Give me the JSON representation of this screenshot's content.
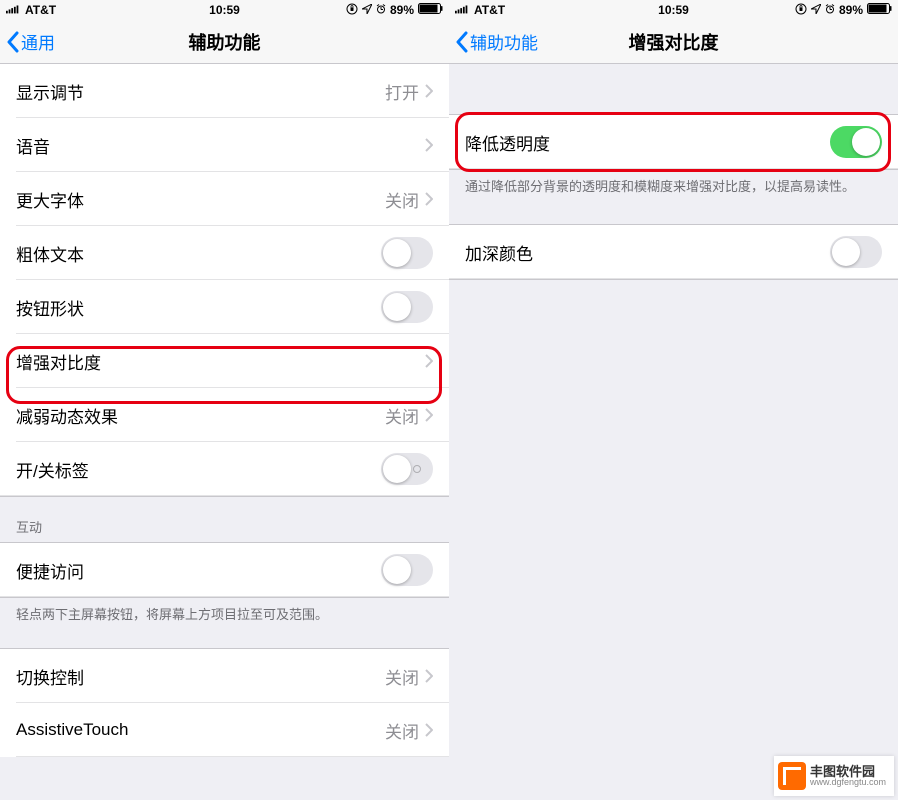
{
  "status": {
    "carrier": "AT&T",
    "time": "10:59",
    "battery_pct": "89%"
  },
  "left": {
    "back_label": "通用",
    "title": "辅助功能",
    "rows": {
      "display": {
        "label": "显示调节",
        "value": "打开"
      },
      "voice": {
        "label": "语音"
      },
      "larger": {
        "label": "更大字体",
        "value": "关闭"
      },
      "bold": {
        "label": "粗体文本"
      },
      "btnshape": {
        "label": "按钮形状"
      },
      "contrast": {
        "label": "增强对比度"
      },
      "motion": {
        "label": "减弱动态效果",
        "value": "关闭"
      },
      "onoff": {
        "label": "开/关标签"
      }
    },
    "section2_header": "互动",
    "rows2": {
      "reach": {
        "label": "便捷访问"
      }
    },
    "footnote2": "轻点两下主屏幕按钮，将屏幕上方项目拉至可及范围。",
    "rows3": {
      "switch": {
        "label": "切换控制",
        "value": "关闭"
      },
      "assistive": {
        "label": "AssistiveTouch",
        "value": "关闭"
      }
    }
  },
  "right": {
    "back_label": "辅助功能",
    "title": "增强对比度",
    "rows": {
      "reduce": {
        "label": "降低透明度"
      }
    },
    "footnote1": "通过降低部分背景的透明度和模糊度来增强对比度，以提高易读性。",
    "rows2": {
      "darken": {
        "label": "加深颜色"
      }
    }
  },
  "watermark": {
    "title": "丰图软件园",
    "url": "www.dgfengtu.com"
  }
}
